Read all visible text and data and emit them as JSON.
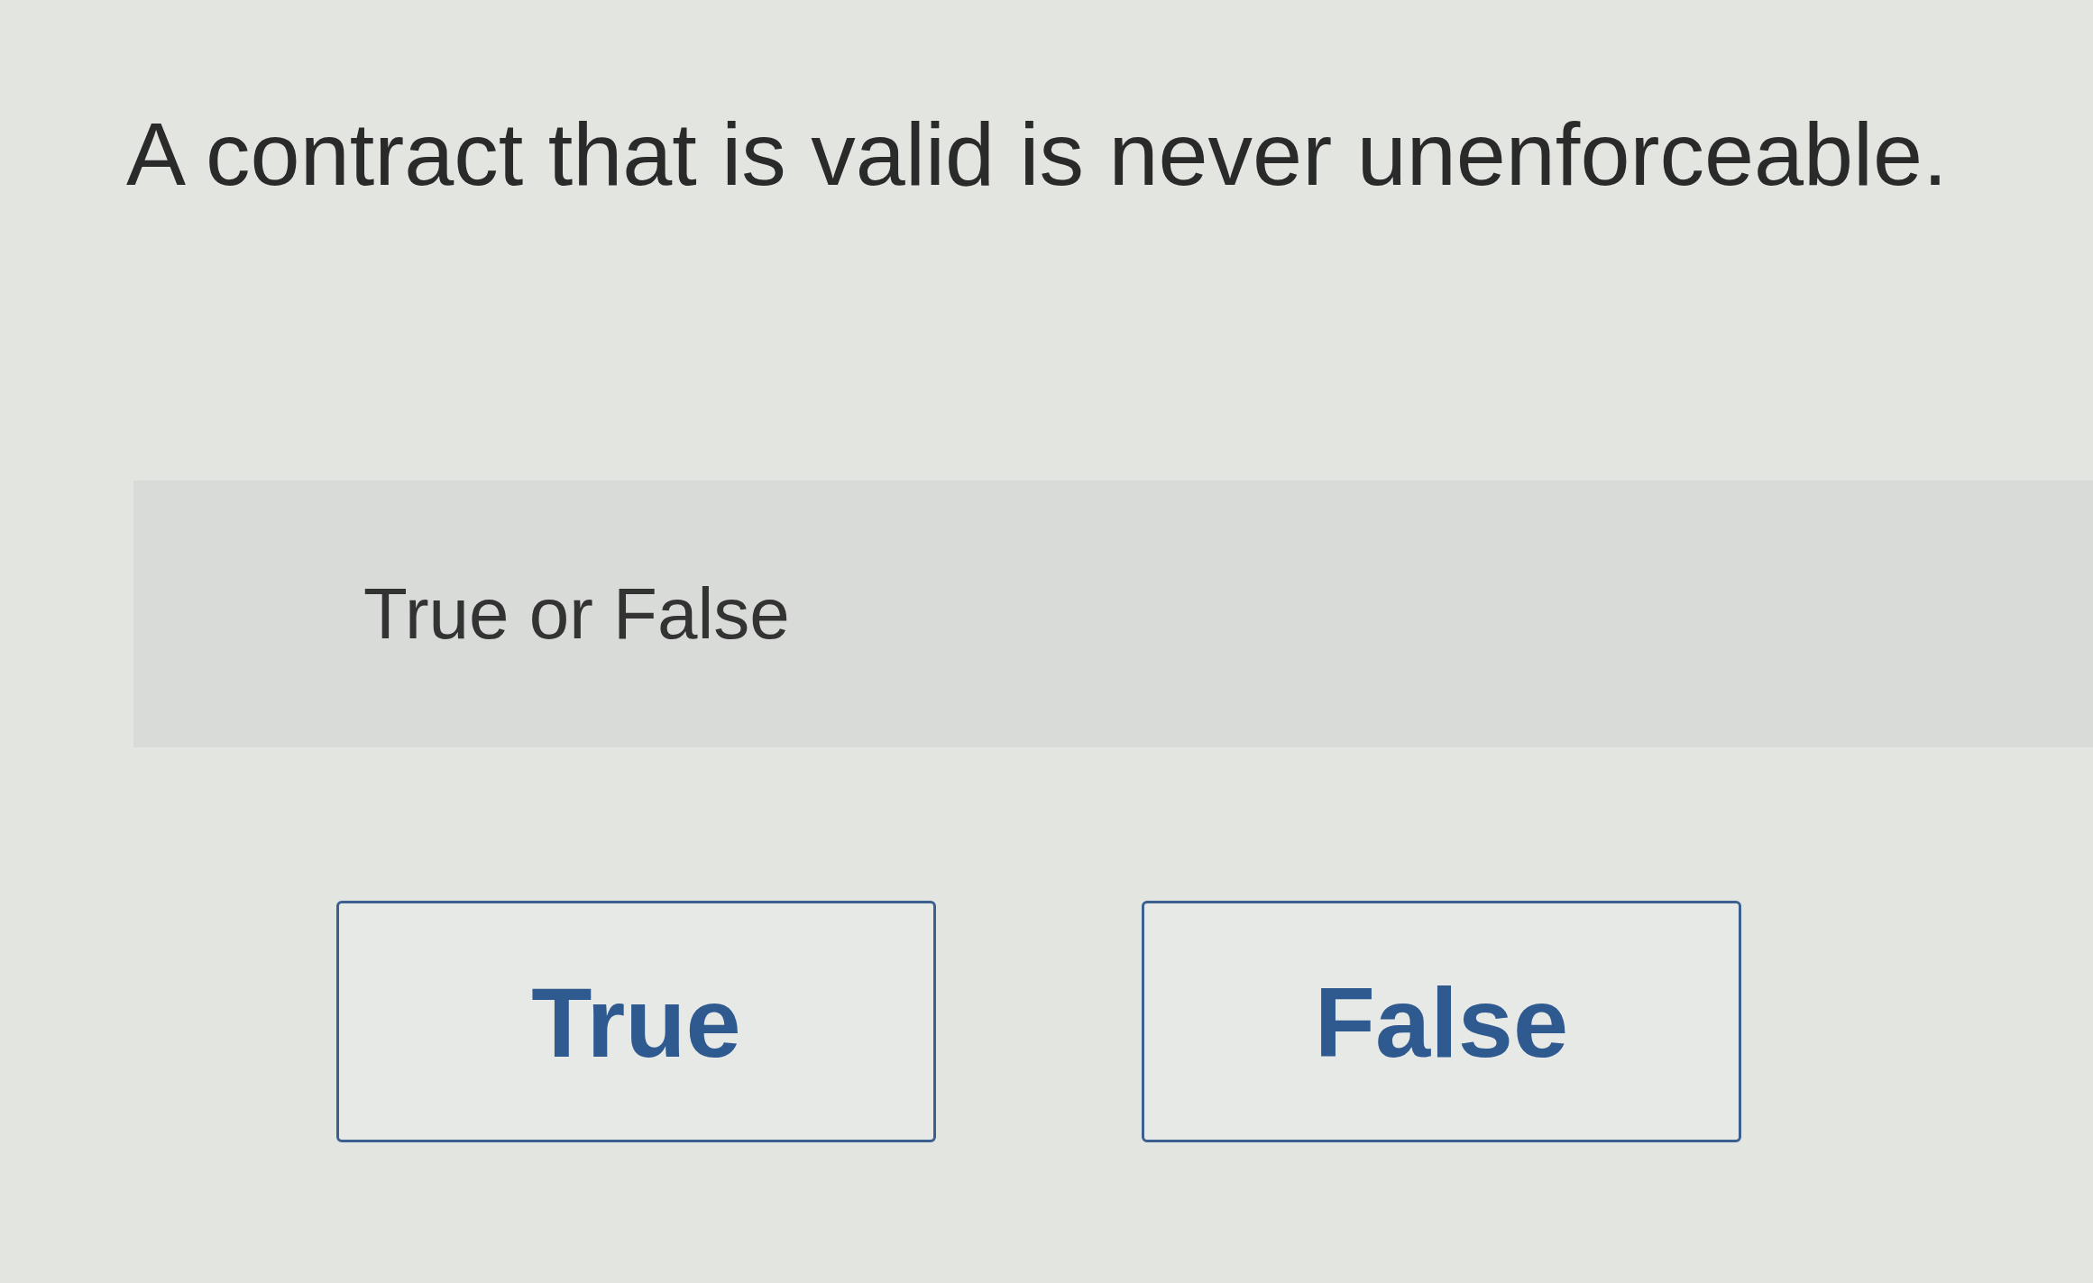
{
  "question": {
    "text": "A contract that is valid is never unenforceable."
  },
  "prompt": {
    "text": "True or False"
  },
  "options": [
    {
      "label": "True",
      "selected": false
    },
    {
      "label": "False",
      "selected": false
    }
  ]
}
